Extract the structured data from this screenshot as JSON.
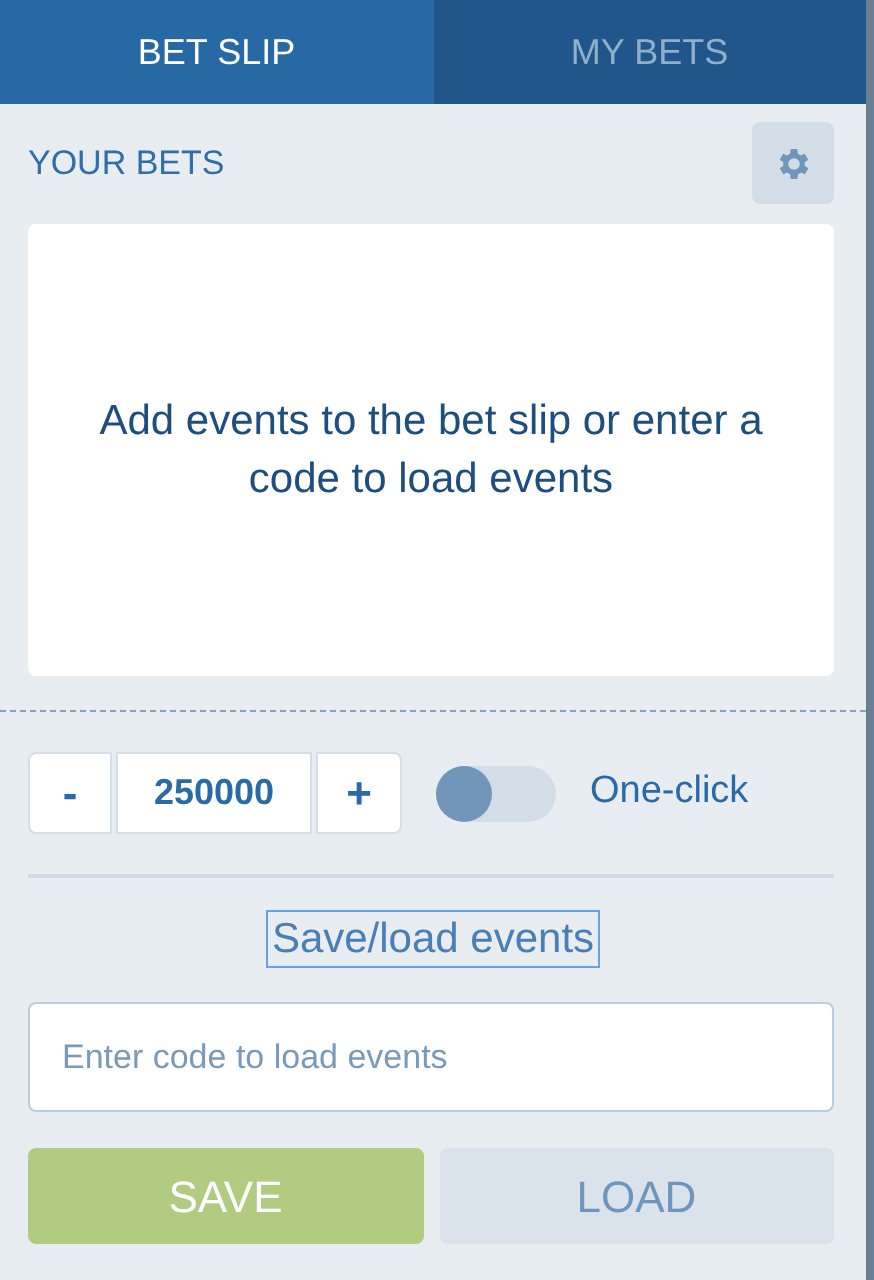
{
  "tabs": [
    {
      "label": "BET SLIP",
      "selected": true
    },
    {
      "label": "MY BETS",
      "selected": false
    }
  ],
  "header": {
    "title": "YOUR BETS"
  },
  "empty_message": "Add events to the bet slip or enter a code to load events",
  "stake": {
    "minus": "-",
    "value": "250000",
    "plus": "+"
  },
  "one_click": {
    "label": "One-click",
    "on": false
  },
  "save_load": {
    "link": "Save/load events",
    "placeholder": "Enter code to load events"
  },
  "buttons": [
    {
      "label": "SAVE",
      "disabled": false
    },
    {
      "label": "LOAD",
      "disabled": true
    }
  ]
}
